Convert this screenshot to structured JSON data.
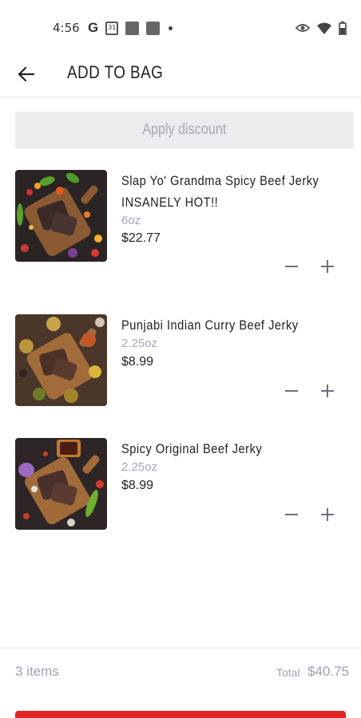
{
  "status_bar": {
    "time": "4:56",
    "icons": [
      "google-icon",
      "calendar-icon",
      "app-icon",
      "app-icon",
      "dot-icon",
      "eye-icon",
      "wifi-icon",
      "battery-icon"
    ],
    "calendar_day": "31"
  },
  "header": {
    "title": "ADD TO BAG",
    "back_icon": "arrow-left-icon"
  },
  "discount": {
    "label": "Apply discount"
  },
  "items": [
    {
      "name_lines": [
        "Slap Yo' Grandma Spicy Beef Jerky",
        "INSANELY HOT!!"
      ],
      "size": "6oz",
      "price": "$22.77"
    },
    {
      "name_lines": [
        "Punjabi Indian Curry Beef Jerky"
      ],
      "size": "2.25oz",
      "price": "$8.99"
    },
    {
      "name_lines": [
        "Spicy Original Beef Jerky"
      ],
      "size": "2.25oz",
      "price": "$8.99"
    }
  ],
  "footer": {
    "item_count": "3 items",
    "total_label": "Total",
    "total_value": "$40.75"
  },
  "colors": {
    "accent": "#e02525",
    "muted_text": "#a4a7ba",
    "discount_bg": "#ececef"
  }
}
